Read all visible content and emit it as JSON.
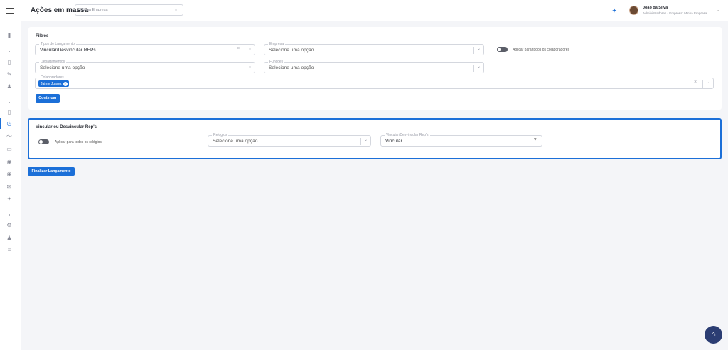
{
  "header": {
    "title": "Ações em massa",
    "company_select_value": "Minha Empresa",
    "user_name": "João da Silva",
    "user_role": "Administradores - Empresa: Minha Empresa"
  },
  "filtros": {
    "title": "Filtros",
    "tipos_label": "Tipos de Lançamento",
    "tipos_value": "Vincular/Desvincular REPs",
    "empresa_label": "Empresa",
    "empresa_placeholder": "Selecione uma opção",
    "aplicar_colaboradores_label": "Aplicar para todos os colaboradores",
    "departamentos_label": "Departamentos",
    "departamentos_placeholder": "Selecione uma opção",
    "funcoes_label": "Funções",
    "funcoes_placeholder": "Selecione uma opção",
    "colaboradores_label": "Colaboradores",
    "colaboradores_chips": [
      "Jaime Juarez"
    ],
    "continuar_button": "Continuar"
  },
  "vincular": {
    "title": "Vincular ou Desvincular Rep's",
    "aplicar_relogios_label": "Aplicar para todos os relógios",
    "relogios_label": "Relogios",
    "relogios_placeholder": "Selecione uma opção",
    "vinc_label": "Vincular/Desvincular Rep's",
    "vinc_value": "Vincular"
  },
  "finalizar_button": "Finalizar Lançamento",
  "colors": {
    "primary": "#1b6fd8",
    "fab": "#2b3d73"
  }
}
